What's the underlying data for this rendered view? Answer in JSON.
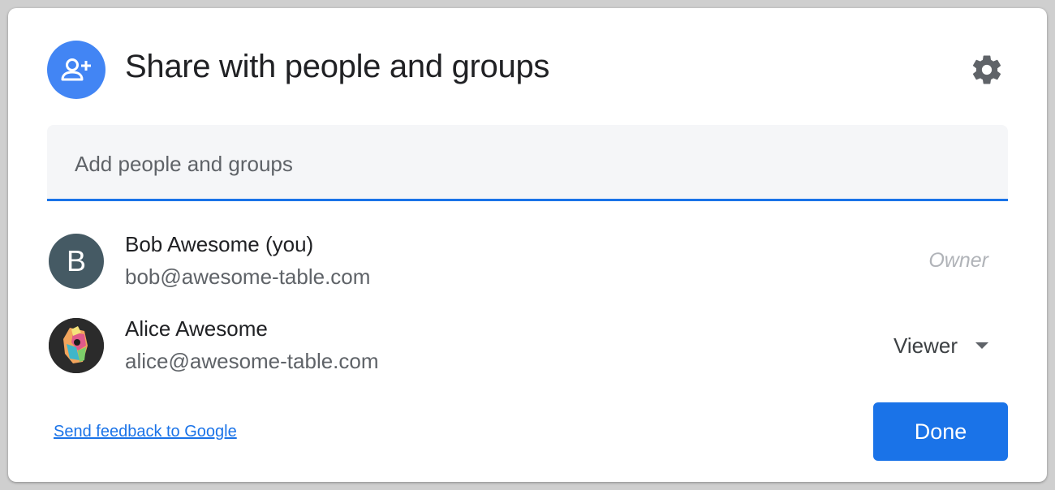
{
  "dialog": {
    "title": "Share with people and groups",
    "header_icon": "person-add-icon",
    "settings_icon": "gear-icon"
  },
  "add_field": {
    "placeholder": "Add people and groups",
    "value": ""
  },
  "people": [
    {
      "avatar_letter": "B",
      "name": "Bob Awesome (you)",
      "email": "bob@awesome-table.com",
      "role": "Owner"
    },
    {
      "avatar_icon": "user-photo",
      "name": "Alice Awesome",
      "email": "alice@awesome-table.com",
      "role": "Viewer"
    }
  ],
  "footer": {
    "feedback_link": "Send feedback to Google",
    "done_button": "Done"
  },
  "colors": {
    "accent": "#1a73e8",
    "header_icon_bg": "#4285f4",
    "avatar_bob_bg": "#455a64"
  }
}
